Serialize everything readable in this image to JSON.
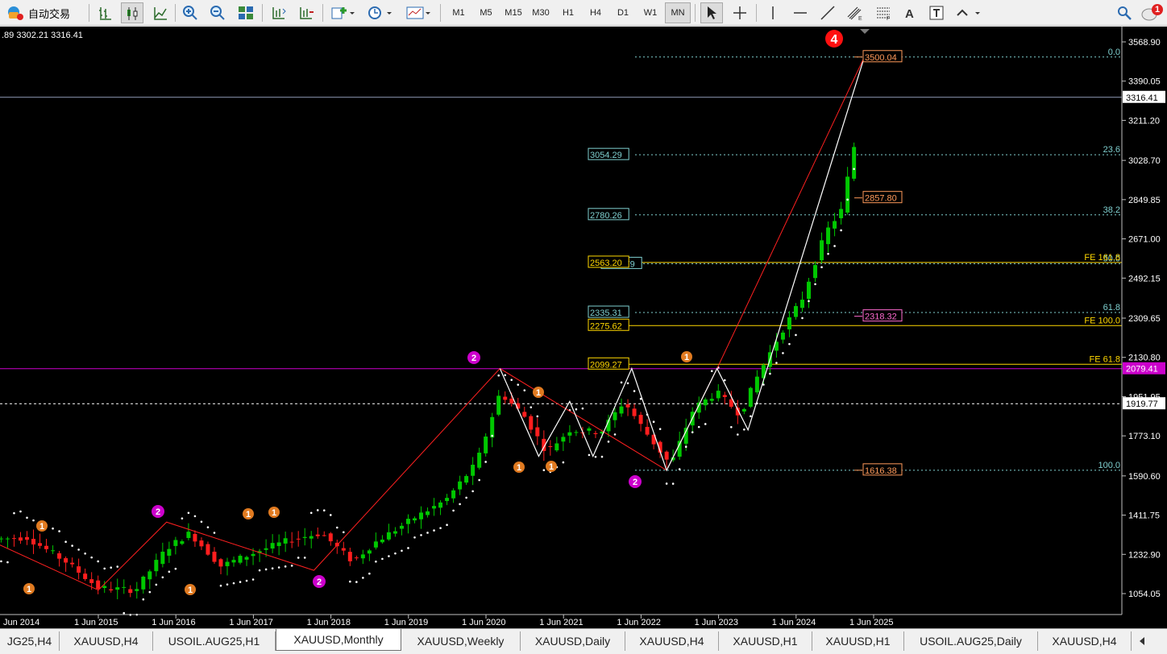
{
  "toolbar": {
    "auto_trade_label": "自动交易",
    "periods": [
      "M1",
      "M5",
      "M15",
      "M30",
      "H1",
      "H4",
      "D1",
      "W1",
      "MN"
    ],
    "active_period": "MN",
    "notification_count": "1"
  },
  "chart": {
    "ohlc_text": ".89 3302.21 3316.41",
    "price_axis": [
      "3568.90",
      "3390.05",
      "3211.20",
      "3028.70",
      "2849.85",
      "2671.00",
      "2492.15",
      "2309.65",
      "2130.80",
      "1951.95",
      "1773.10",
      "1590.60",
      "1411.75",
      "1232.90",
      "1054.05"
    ],
    "current_price": "3316.41",
    "magenta_level": "2079.41",
    "dotted_level": "1919.77",
    "time_axis": [
      "Jun 2014",
      "1 Jun 2015",
      "1 Jun 2016",
      "1 Jun 2017",
      "1 Jun 2018",
      "1 Jun 2019",
      "1 Jun 2020",
      "1 Jun 2021",
      "1 Jun 2022",
      "1 Jun 2023",
      "1 Jun 2024",
      "1 Jun 2025"
    ],
    "fib_levels": [
      {
        "label": "0.0",
        "price": "3500.04"
      },
      {
        "label": "23.6",
        "price": "3054.29"
      },
      {
        "label": "38.2",
        "price": "2780.26"
      },
      {
        "label": "50.0",
        "price": "2557.79"
      },
      {
        "label": "61.8",
        "price": "2335.31"
      },
      {
        "label": "100.0",
        "price": "1616.38"
      }
    ],
    "fe_levels": [
      {
        "label": "FE 161.8",
        "price": "2563.20"
      },
      {
        "label": "FE 100.0",
        "price": "2275.62"
      },
      {
        "label": "FE 61.8",
        "price": "2099.27"
      }
    ],
    "right_labels": [
      "3500.04",
      "2857.80",
      "2318.32",
      "1616.38"
    ],
    "wave_labels": [
      "4",
      "2",
      "2",
      "2",
      "1",
      "1",
      "1",
      "1",
      "1",
      "1",
      "1",
      "1",
      "1",
      "2"
    ]
  },
  "tabs": [
    "JG25,H4",
    "XAUUSD,H4",
    "USOIL.AUG25,H1",
    "XAUUSD,Monthly",
    "XAUUSD,Weekly",
    "XAUUSD,Daily",
    "XAUUSD,H4",
    "XAUUSD,H1",
    "XAUUSD,H1",
    "USOIL.AUG25,Daily",
    "XAUUSD,H4"
  ],
  "active_tab": "XAUUSD,Monthly",
  "colors": {
    "bull": "#00c800",
    "bear": "#ff1e1e",
    "magenta": "#cc00cc",
    "fib": "#7fd0d0",
    "fe": "#ffd700"
  }
}
